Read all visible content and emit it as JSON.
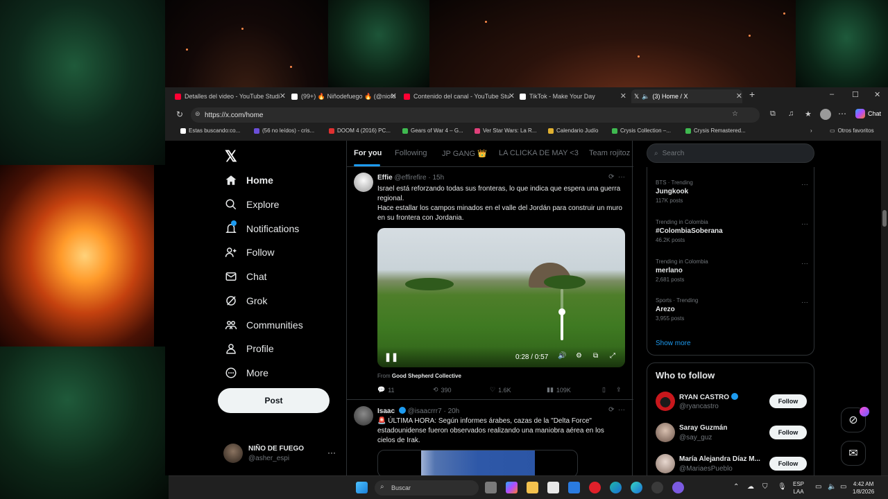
{
  "tabs": [
    {
      "label": "Detalles del video - YouTube Studi",
      "color": "#ff0033"
    },
    {
      "label": "(99+) 🔥 Niñodefuego 🔥 (@niofu",
      "color": "#ffffff"
    },
    {
      "label": "Contenido del canal - YouTube Stu",
      "color": "#ff0033"
    },
    {
      "label": "TikTok - Make Your Day",
      "color": "#ffffff"
    },
    {
      "label": "(3) Home / X",
      "color": "#ffffff"
    }
  ],
  "address": {
    "url": "https://x.com/home",
    "chat_label": "Chat"
  },
  "favorites": [
    {
      "label": "Estas buscando:co...",
      "color": "#ffffff"
    },
    {
      "label": "(56 no leídos) - cris...",
      "color": "#6b4fd8"
    },
    {
      "label": "DOOM 4 (2016) PC...",
      "color": "#e03030"
    },
    {
      "label": "Gears of War 4 – G...",
      "color": "#3fb950"
    },
    {
      "label": "Ver Star Wars: La R...",
      "color": "#e0407a"
    },
    {
      "label": "Calendario Judío",
      "color": "#e0b030"
    },
    {
      "label": "Crysis Collection –...",
      "color": "#3fb950"
    },
    {
      "label": "Crysis Remastered...",
      "color": "#3fb950"
    },
    {
      "label": "Otros favoritos",
      "color": "#cccccc"
    }
  ],
  "nav": {
    "items": [
      {
        "label": "Home",
        "icon": "home-icon"
      },
      {
        "label": "Explore",
        "icon": "search-icon"
      },
      {
        "label": "Notifications",
        "icon": "bell-icon"
      },
      {
        "label": "Follow",
        "icon": "add-user-icon"
      },
      {
        "label": "Chat",
        "icon": "mail-icon"
      },
      {
        "label": "Grok",
        "icon": "grok-icon"
      },
      {
        "label": "Communities",
        "icon": "people-icon"
      },
      {
        "label": "Profile",
        "icon": "person-icon"
      },
      {
        "label": "More",
        "icon": "more-circle-icon"
      }
    ],
    "post_label": "Post",
    "account": {
      "name": "NIÑO DE FUEGO",
      "handle": "@asher_espi"
    }
  },
  "feed": {
    "tabs": [
      "For you",
      "Following",
      "JP GANG 👑",
      "LA CLICKA DE MAY <3",
      "Team rojitoz"
    ],
    "tweets": [
      {
        "name": "Effie",
        "handle": "@effirefire",
        "time": "15h",
        "text1": "Israel está reforzando todas sus fronteras, lo que indica que espera una guerra regional.",
        "text2": "Hace estallar los campos minados en el valle del Jordán  para construir un muro en su frontera con Jordania.",
        "video": {
          "time": "0:28 / 0:57",
          "progress": 0.491,
          "volume": 0.6
        },
        "from_label": "From",
        "from_source": "Good Shepherd Collective",
        "replies": "11",
        "reposts": "390",
        "likes": "1.6K",
        "views": "109K"
      },
      {
        "name": "Isaac",
        "handle": "@isaacrrr7",
        "time": "20h",
        "text": "🚨 ÚLTIMA HORA: Según informes árabes, cazas de la \"Delta Force\" estadounidense fueron observados realizando una maniobra aérea en los cielos de Irak."
      }
    ]
  },
  "search": {
    "placeholder": "Search"
  },
  "trends": [
    {
      "context": "BTS · Trending",
      "name": "Jungkook",
      "count": "117K posts"
    },
    {
      "context": "Trending in Colombia",
      "name": "#ColombiaSoberana",
      "count": "46.2K posts"
    },
    {
      "context": "Trending in Colombia",
      "name": "merlano",
      "count": "2,681 posts"
    },
    {
      "context": "Sports · Trending",
      "name": "Arezo",
      "count": "3,955 posts"
    }
  ],
  "show_more": "Show more",
  "who_to_follow": {
    "title": "Who to follow",
    "follow_label": "Follow",
    "accounts": [
      {
        "name": "RYAN CASTRO",
        "handle": "@ryancastro",
        "verified": true,
        "avatar_color": "#c8171c"
      },
      {
        "name": "Saray Guzmán",
        "handle": "@say_guz",
        "verified": false,
        "avatar_color": "#b89a8a"
      },
      {
        "name": "María Alejandra Díaz M...",
        "handle": "@MariaesPueblo",
        "verified": false,
        "avatar_color": "#d0c0b8"
      }
    ]
  },
  "taskbar": {
    "search_placeholder": "Buscar",
    "lang1": "ESP",
    "lang2": "LAA",
    "time": "4:42 AM",
    "date": "1/8/2026"
  }
}
